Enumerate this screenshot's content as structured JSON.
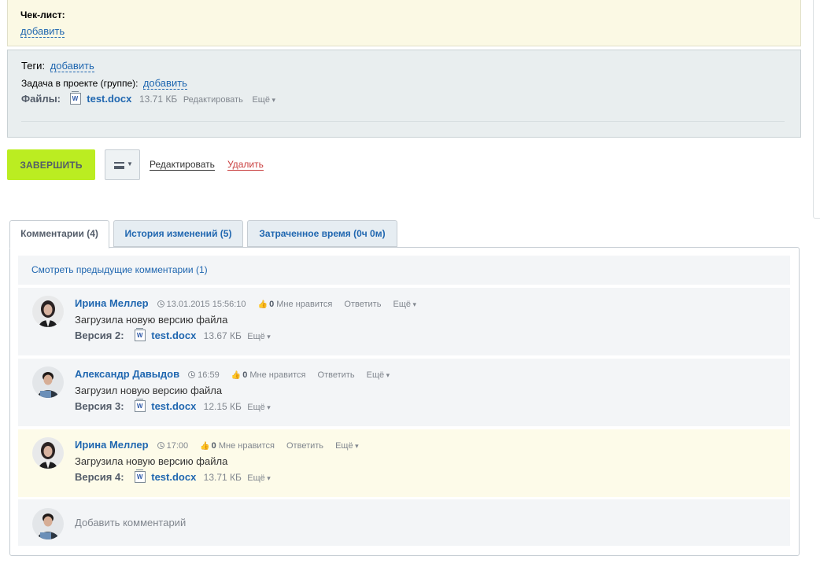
{
  "checklist": {
    "label": "Чек-лист:",
    "add_link": "добавить"
  },
  "props": {
    "tags_label": "Теги:",
    "tags_add": "добавить",
    "project_label": "Задача в проекте (группе):",
    "project_add": "добавить",
    "files_label": "Файлы:",
    "file": {
      "name": "test.docx",
      "size": "13.71 КБ",
      "edit": "Редактировать",
      "more": "Ещё"
    }
  },
  "actions": {
    "complete": "ЗАВЕРШИТЬ",
    "edit": "Редактировать",
    "delete": "Удалить"
  },
  "tabs": [
    {
      "label": "Комментарии (4)",
      "active": true
    },
    {
      "label": "История изменений (5)",
      "active": false
    },
    {
      "label": "Затраченное время (0ч 0м)",
      "active": false
    }
  ],
  "comments_panel": {
    "prev_link": "Смотреть предыдущие комментарии (1)",
    "comments": [
      {
        "author": "Ирина Меллер",
        "time": "13.01.2015 15:56:10",
        "likes": "0",
        "like_label": "Мне нравится",
        "reply": "Ответить",
        "more": "Ещё",
        "text": "Загрузила новую версию файла",
        "version_label": "Версия 2:",
        "file": "test.docx",
        "size": "13.67 КБ",
        "file_more": "Ещё"
      },
      {
        "author": "Александр Давыдов",
        "time": "16:59",
        "likes": "0",
        "like_label": "Мне нравится",
        "reply": "Ответить",
        "more": "Ещё",
        "text": "Загрузил новую версию файла",
        "version_label": "Версия 3:",
        "file": "test.docx",
        "size": "12.15 КБ",
        "file_more": "Ещё"
      },
      {
        "author": "Ирина Меллер",
        "time": "17:00",
        "likes": "0",
        "like_label": "Мне нравится",
        "reply": "Ответить",
        "more": "Ещё",
        "text": "Загрузила новую версию файла",
        "version_label": "Версия 4:",
        "file": "test.docx",
        "size": "13.71 КБ",
        "file_more": "Ещё"
      }
    ],
    "add_comment": "Добавить комментарий"
  },
  "colors": {
    "accent": "#2067b0",
    "complete_button": "#bbed21",
    "delete": "#c93e3e",
    "highlight": "#fdfbe9"
  }
}
